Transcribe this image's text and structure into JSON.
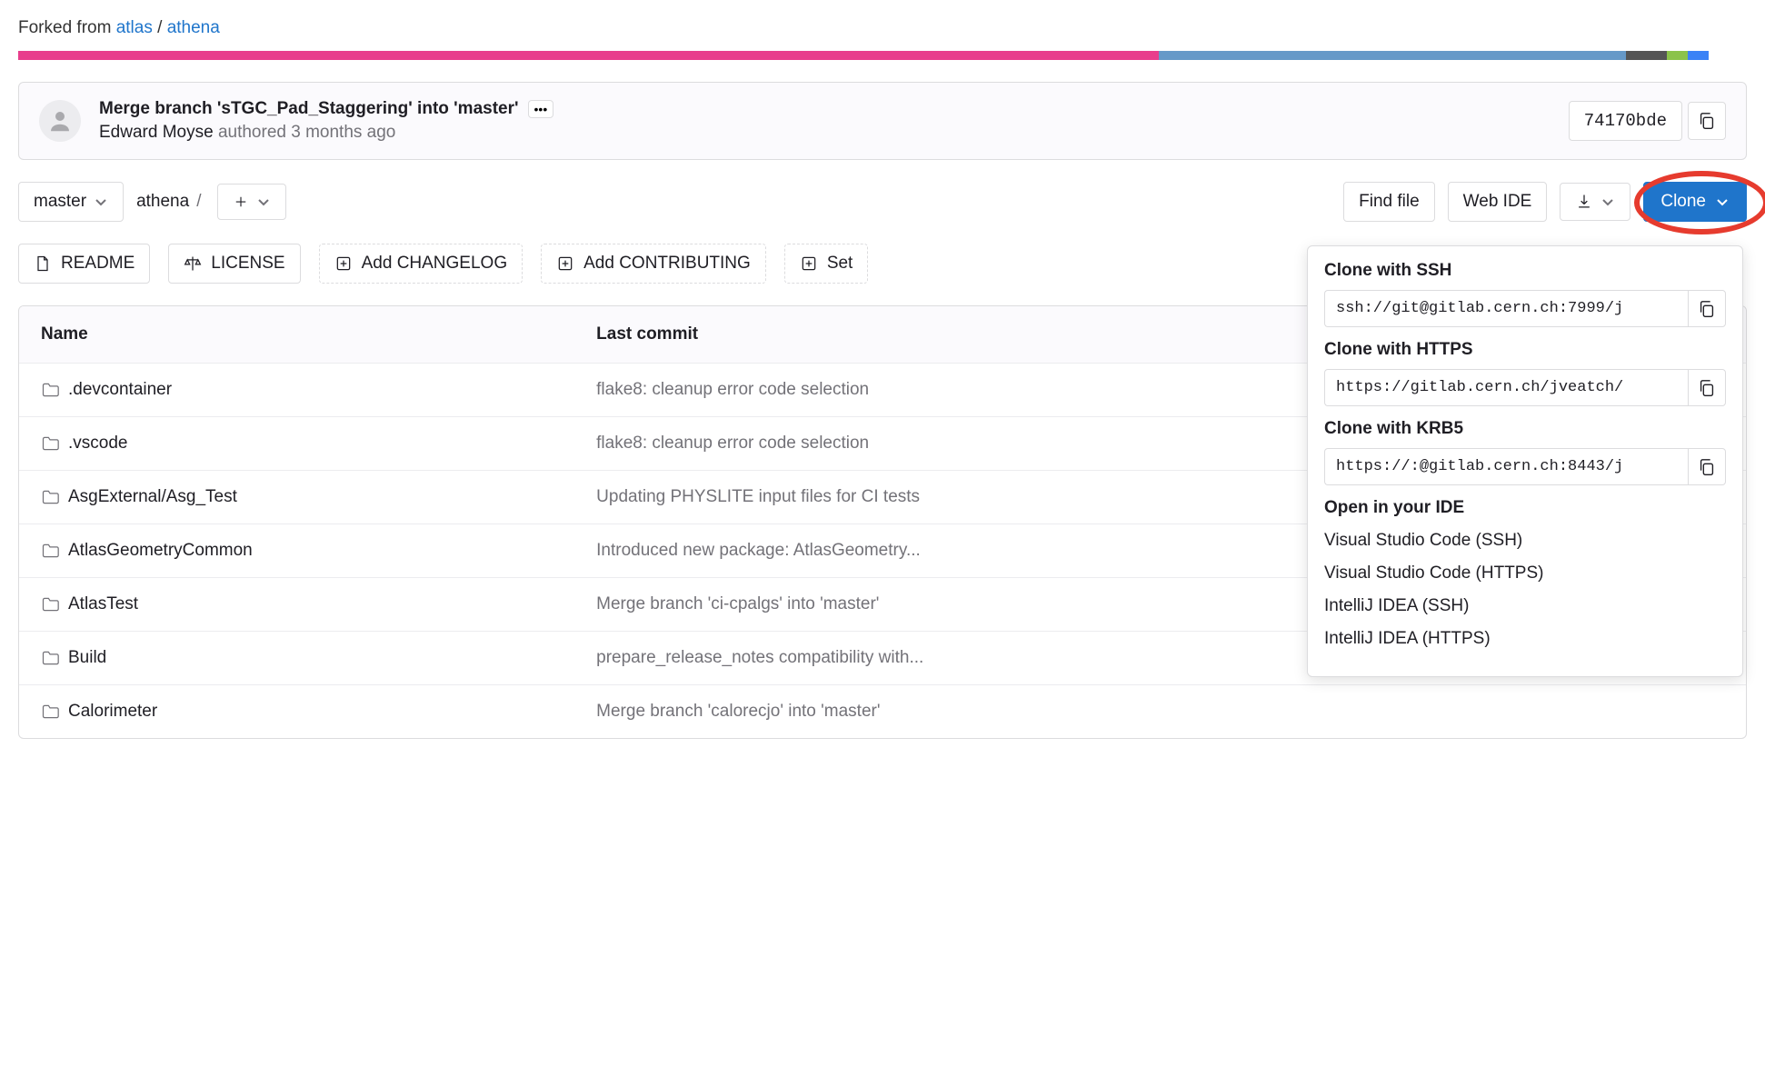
{
  "forked_from": {
    "prefix": "Forked from ",
    "group": "atlas",
    "project": "athena"
  },
  "colorbar_segments": [
    "pink",
    "blue",
    "gray",
    "green",
    "lblue"
  ],
  "commit": {
    "title": "Merge branch 'sTGC_Pad_Staggering' into 'master'",
    "author": "Edward Moyse",
    "authored_text": "authored 3 months ago",
    "sha": "74170bde"
  },
  "toolbar": {
    "branch": "master",
    "breadcrumb_root": "athena",
    "find_file": "Find file",
    "web_ide": "Web IDE",
    "clone": "Clone"
  },
  "chips": {
    "readme": "README",
    "license": "LICENSE",
    "add_changelog": "Add CHANGELOG",
    "add_contributing": "Add CONTRIBUTING",
    "set_partial": "Set"
  },
  "table": {
    "headers": {
      "name": "Name",
      "last_commit": "Last commit"
    },
    "rows": [
      {
        "name": ".devcontainer",
        "commit": "flake8: cleanup error code selection"
      },
      {
        "name": ".vscode",
        "commit": "flake8: cleanup error code selection"
      },
      {
        "name": "AsgExternal/Asg_Test",
        "commit": "Updating PHYSLITE input files for CI tests"
      },
      {
        "name": "AtlasGeometryCommon",
        "commit": "Introduced new package: AtlasGeometry..."
      },
      {
        "name": "AtlasTest",
        "commit": "Merge branch 'ci-cpalgs' into 'master'"
      },
      {
        "name": "Build",
        "commit": "prepare_release_notes compatibility with..."
      },
      {
        "name": "Calorimeter",
        "commit": "Merge branch 'calorecjo' into 'master'"
      }
    ]
  },
  "clone_dropdown": {
    "ssh_label": "Clone with SSH",
    "ssh_url": "ssh://git@gitlab.cern.ch:7999/j",
    "https_label": "Clone with HTTPS",
    "https_url": "https://gitlab.cern.ch/jveatch/",
    "krb5_label": "Clone with KRB5",
    "krb5_url": "https://:@gitlab.cern.ch:8443/j",
    "open_ide_label": "Open in your IDE",
    "ide_options": [
      "Visual Studio Code (SSH)",
      "Visual Studio Code (HTTPS)",
      "IntelliJ IDEA (SSH)",
      "IntelliJ IDEA (HTTPS)"
    ]
  }
}
